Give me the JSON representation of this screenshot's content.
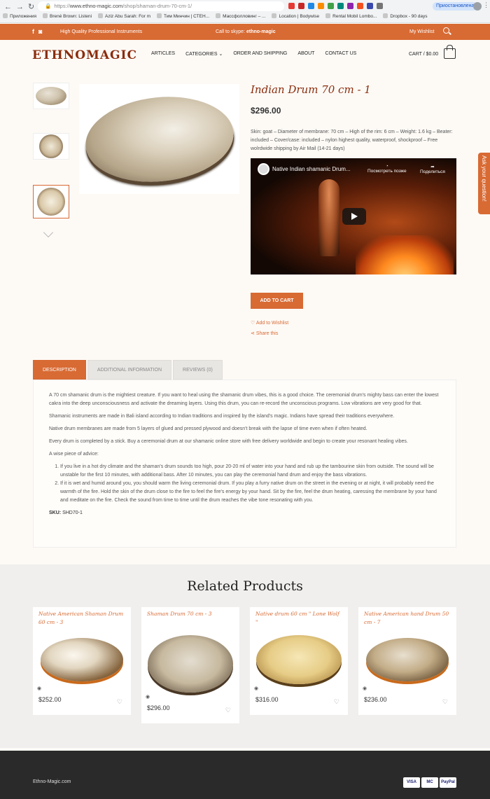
{
  "browser": {
    "url_scheme": "https://",
    "url_domain": "www.ethno-magic.com",
    "url_path": "/shop/shaman-drum-70-cm-1/",
    "profile_label": "Приостановлена",
    "bookmarks": [
      "Приложения",
      "Brené Brown: Listeni",
      "Aziz Abu Sarah: For m",
      "Тим Минчин | СТЕН...",
      "Массфолловинг – ...",
      "Location | Bodywise",
      "Rental Mobil Lombo...",
      "Dropbox - 90 days"
    ]
  },
  "topbar": {
    "tagline": "High Quality Professional Instruments",
    "skype_prefix": "Call to skype:",
    "skype_id": "ethno-magic",
    "wishlist": "My Wishlist"
  },
  "header": {
    "logo": "ETHNOMAGIC",
    "nav": [
      "ARTICLES",
      "CATEGORIES",
      "ORDER AND SHIPPING",
      "ABOUT",
      "CONTACT US"
    ],
    "cart": "CART / $0.00"
  },
  "product": {
    "title": "Indian Drum 70 cm - 1",
    "price": "$296.00",
    "short_description": "Skin: goat – Diameter of membrane: 70 cm – High of the rim: 6 cm – Weight: 1.6 kg – Beater: included – Cover/case: included – nylon highest quality, waterproof, shockproof – Free wolrdwide shipping by Air Mail (14-21 days)",
    "video_title": "Native Indian shamanic Drum...",
    "video_watch_later": "Посмотреть позже",
    "video_share": "Поделиться",
    "add_to_cart": "ADD TO CART",
    "add_to_wishlist": "Add to Wishlist",
    "share": "Share this"
  },
  "tabs": [
    "DESCRIPTION",
    "ADDITIONAL INFORMATION",
    "REVIEWS (0)"
  ],
  "description": {
    "paragraphs": [
      "A 70 cm  shamanic drum is the mightiest creature. If you want to heal using the shamanic drum vibes, this is a good choice. The ceremonial drum's mighty bass can enter the lowest cakra into the deep unconsciousness and activate the dreaming layers. Using this drum, you can re-record the unconscious programs. Low vibrations are very good for that.",
      "Shamanic instruments are made in Bali  island according to Indian traditions and inspired by the island's magic. Indians have spread their traditions everywhere.",
      "Native drum membranes are made from 5 layers of glued and pressed plywood and doesn't break with the lapse of time even when if often heated.",
      "Every drum is completed by a stick. Buy a ceremonial  drum at our shamanic online store with free delivery worldwide and begin to create your resonant healing vibes.",
      "A wise piece of advice:"
    ],
    "list": [
      "If you live in a hot dry climate and the shaman's drum sounds too high, pour 20-20 ml of water into your hand and rub up the tambourine skin from outside. The sound will be unstable for the first 10 minutes, with additional bass. After 10 minutes, you can play the ceremonial hand drum and enjoy the bass vibrations.",
      "If it is wet and humid around you, you should warm the living ceremonial drum. If you play a furry native drum on the street in the evening or at night, it will probably need the warmth of the fire. Hold the skin of the drum close to the fire to feel the fire's energy by your hand. Sit by the fire, feel the drum heating, caressing the membrane by your hand and meditate on the fire. Check the sound from time to time until the drum reaches the vibe tone resonating with you."
    ],
    "sku_label": "SKU:",
    "sku_value": "SHD70-1"
  },
  "related": {
    "title": "Related Products",
    "items": [
      {
        "name": "Native American Shaman Drum 60 cm - 3",
        "price": "$252.00"
      },
      {
        "name": "Shaman Drum 70 cm - 3",
        "price": "$296.00"
      },
      {
        "name": "Native drum 60 cm \" Lone Wolf \"",
        "price": "$316.00"
      },
      {
        "name": "Native American hand Drum 50 cm - 7",
        "price": "$236.00"
      }
    ]
  },
  "footer": {
    "brand": "Ethno-Magic.com",
    "payments": [
      "VISA",
      "MC",
      "PayPal"
    ]
  },
  "side_tab": "Ask your question!",
  "colors": {
    "accent": "#d86a33",
    "logo": "#8a2d0d",
    "footer": "#2a2a2a"
  }
}
